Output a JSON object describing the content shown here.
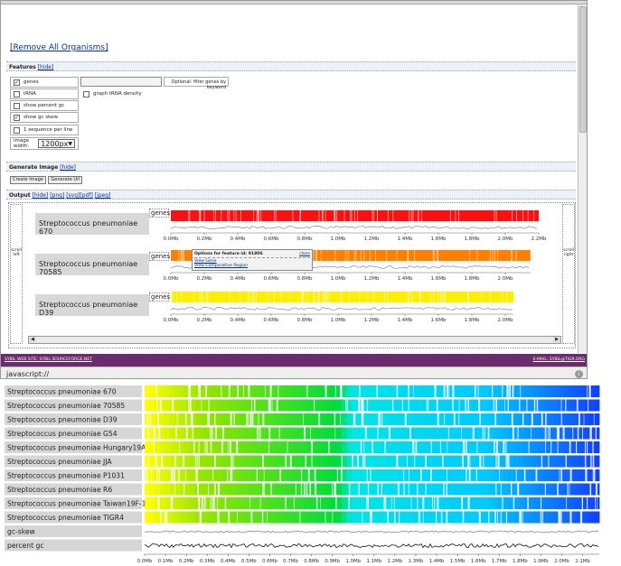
{
  "top_panel": {
    "remove_all_link": "[Remove All Organisms]",
    "features": {
      "title": "Features",
      "hide_link": "[hide]",
      "options": [
        {
          "label": "genes",
          "checked": true
        },
        {
          "label": "tRNA",
          "checked": false
        },
        {
          "label": "show percent gc",
          "checked": false
        },
        {
          "label": "show gc skew",
          "checked": true
        },
        {
          "label": "1 sequence per line",
          "checked": false
        }
      ],
      "graph_trna_label": "graph tRNA density",
      "filter_placeholder": "",
      "filter_label": "Optional: filter genes by keyword",
      "image_width_label": "image width:",
      "image_width_value": "1200px"
    },
    "generate": {
      "title": "Generate Image",
      "hide_link": "[hide]",
      "create_button": "Create Image",
      "generate_url_button": "Generate Url"
    },
    "output": {
      "title": "Output",
      "links": [
        "[hide]",
        "[png]",
        "[svg]",
        "[pdf]",
        "[jpeg]"
      ],
      "scroll_left": "scroll left",
      "scroll_right": "scroll right",
      "genes_label": "genes",
      "organisms": [
        {
          "name": "Streptococcus pneumoniae 670",
          "color": "#ff1010"
        },
        {
          "name": "Streptococcus pneumoniae 70585",
          "color": "#ff8000"
        },
        {
          "name": "Streptococcus pneumoniae D39",
          "color": "#ffee00"
        }
      ],
      "axis_ticks": [
        [
          "0.0Mb",
          "0.2Mb",
          "0.4Mb",
          "0.6Mb",
          "0.8Mb",
          "1.0Mb",
          "1.2Mb",
          "1.4Mb",
          "1.6Mb",
          "1.8Mb",
          "2.0Mb",
          "2.2Mb"
        ],
        [
          "0.0Mb",
          "0.2Mb",
          "0.4Mb",
          "0.6Mb",
          "0.8Mb",
          "1.0Mb",
          "1.2Mb",
          "1.4Mb",
          "1.6Mb",
          "1.8Mb",
          "2.0Mb"
        ],
        [
          "0.0Mb",
          "0.2Mb",
          "0.4Mb",
          "0.6Mb",
          "0.8Mb",
          "1.0Mb",
          "1.2Mb",
          "1.4Mb",
          "1.6Mb",
          "1.8Mb",
          "2.0Mb"
        ]
      ],
      "track_ends_mb": [
        2.2,
        2.15,
        2.05
      ],
      "popup": {
        "title": "Options for feature id: 91806",
        "close": "close",
        "view_gene": "View Gene",
        "view_region": "View Comparative Region"
      }
    },
    "footer": {
      "left": "SYBIL WEB SITE: SYBIL.SOURCEFORGE.NET",
      "right": "E-MAIL: SYBIL@TIGR.ORG"
    },
    "status": {
      "url": "javascript://"
    }
  },
  "viewer": {
    "organisms": [
      "Streptococcus pneumoniae 670",
      "Streptococcus pneumoniae 70585",
      "Streptococcus pneumoniae D39",
      "Streptococcus pneumoniae G54",
      "Streptococcus pneumoniae Hungary19A-6",
      "Streptococcus pneumoniae JJA",
      "Streptococcus pneumoniae P1031",
      "Streptococcus pneumoniae R6",
      "Streptococcus pneumoniae Taiwan19F-14",
      "Streptococcus pneumoniae TIGR4"
    ],
    "extra_tracks": [
      "gc-skew",
      "percent gc"
    ],
    "axis_ticks": [
      "0.0Mb",
      "0.1Mb",
      "0.2Mb",
      "0.3Mb",
      "0.4Mb",
      "0.5Mb",
      "0.6Mb",
      "0.7Mb",
      "0.8Mb",
      "0.9Mb",
      "1.0Mb",
      "1.1Mb",
      "1.2Mb",
      "1.3Mb",
      "1.4Mb",
      "1.5Mb",
      "1.6Mb",
      "1.7Mb",
      "1.8Mb",
      "1.9Mb",
      "2.0Mb",
      "2.1Mb"
    ]
  },
  "colors": {
    "footer": "#6b2c6e",
    "section": "#eef0f8",
    "link": "#003399"
  }
}
